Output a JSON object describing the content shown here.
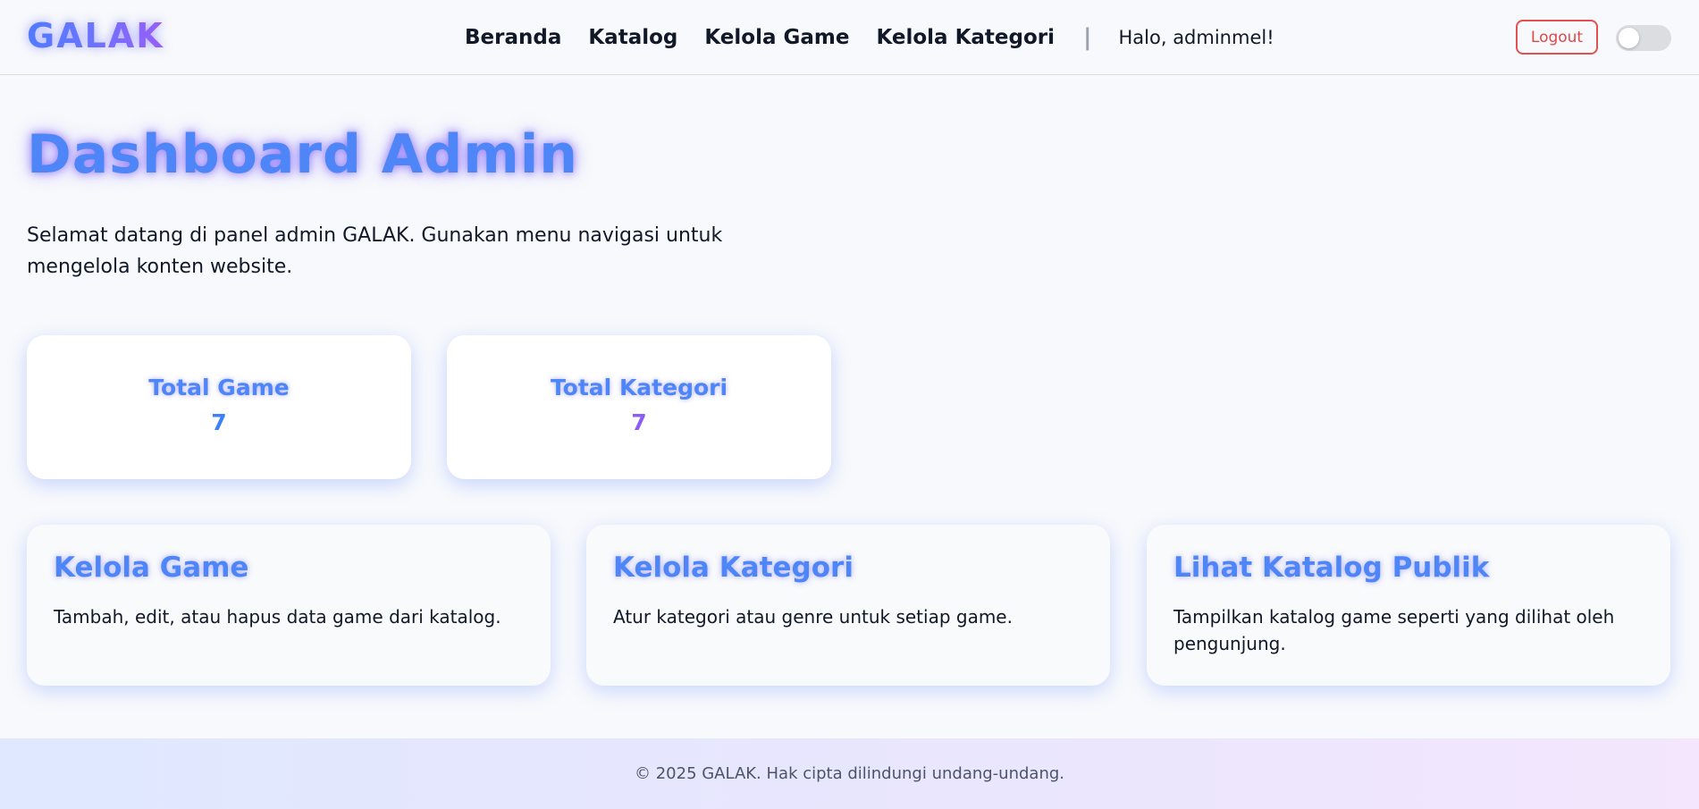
{
  "brand": {
    "logo_text": "GALAK",
    "accent_blue": "#4f86f7",
    "accent_purple": "#8b5cf6"
  },
  "nav": {
    "links": [
      {
        "label": "Beranda"
      },
      {
        "label": "Katalog"
      },
      {
        "label": "Kelola Game"
      },
      {
        "label": "Kelola Kategori"
      }
    ],
    "separator": "|",
    "greeting": "Halo, adminmel!",
    "logout_label": "Logout",
    "theme_toggle_on": false
  },
  "main": {
    "title": "Dashboard Admin",
    "welcome": "Selamat datang di panel admin GALAK. Gunakan menu navigasi untuk mengelola konten website.",
    "stats": [
      {
        "label": "Total Game",
        "value": "7",
        "color": "#3b82f6"
      },
      {
        "label": "Total Kategori",
        "value": "7",
        "color": "#8b5cf6"
      }
    ],
    "actions": [
      {
        "title": "Kelola Game",
        "description": "Tambah, edit, atau hapus data game dari katalog."
      },
      {
        "title": "Kelola Kategori",
        "description": "Atur kategori atau genre untuk setiap game."
      },
      {
        "title": "Lihat Katalog Publik",
        "description": "Tampilkan katalog game seperti yang dilihat oleh pengunjung."
      }
    ]
  },
  "footer": {
    "text": "© 2025 GALAK. Hak cipta dilindungi undang-undang."
  }
}
